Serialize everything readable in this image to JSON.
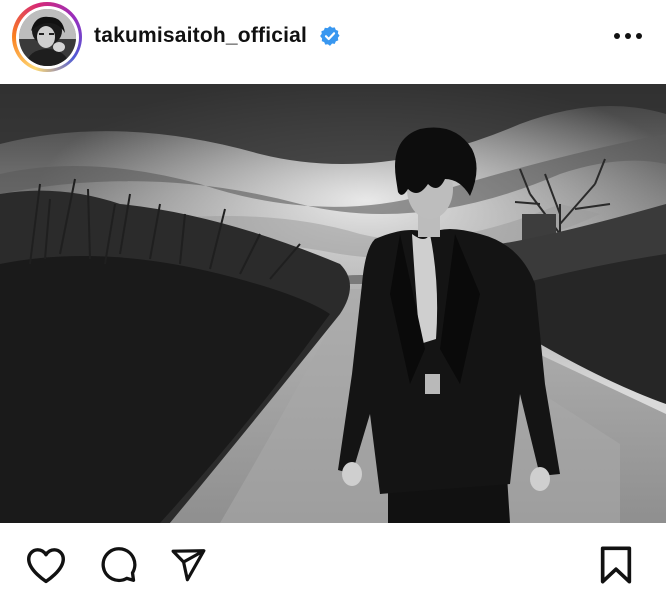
{
  "post": {
    "username": "takumisaitoh_official",
    "verified": true,
    "verified_color": "#3897f0",
    "avatar_ring_colors": [
      "#feda75",
      "#fa7e1e",
      "#d62976",
      "#962fbf",
      "#4f5bd5"
    ]
  },
  "photo": {
    "style": "black-and-white"
  },
  "icons": {
    "more": "more-horizontal-icon",
    "like": "heart-outline-icon",
    "comment": "comment-bubble-icon",
    "share": "paper-plane-icon",
    "save": "bookmark-outline-icon"
  }
}
